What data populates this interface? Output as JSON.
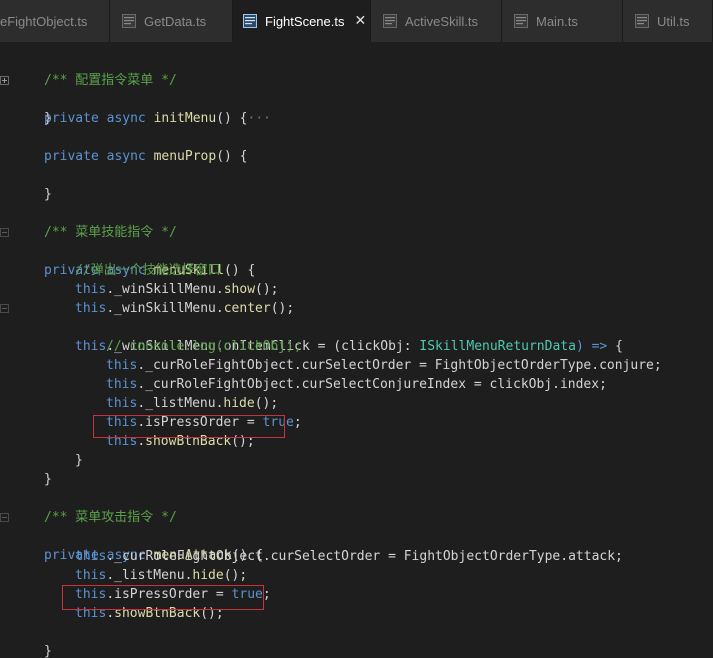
{
  "tabs": [
    {
      "label": "eFightObject.ts",
      "active": false
    },
    {
      "label": "GetData.ts",
      "active": false
    },
    {
      "label": "FightScene.ts",
      "active": true
    },
    {
      "label": "ActiveSkill.ts",
      "active": false
    },
    {
      "label": "Main.ts",
      "active": false
    },
    {
      "label": "Util.ts",
      "active": false
    }
  ],
  "close_glyph": "✕",
  "fold_collapsed_marker": "···",
  "code": {
    "l1_comment": "/** 配置指令菜单 */",
    "l2_kw": "private async",
    "l2_fn": "initMenu",
    "l2_rest": "() {",
    "l3": "}",
    "l4_kw": "private async",
    "l4_fn": "menuProp",
    "l4_rest": "() {",
    "l5": "}",
    "l6_comment": "/** 菜单技能指令 */",
    "l7_kw": "private async",
    "l7_fn": "menuSkill",
    "l7_rest": "() {",
    "l8_comment": "//弹出一个技能选择窗口",
    "l9_this": "this",
    "l9_rest": "._winSkillMenu.",
    "l9_fn": "show",
    "l9_end": "();",
    "l10_this": "this",
    "l10_rest": "._winSkillMenu.",
    "l10_fn": "center",
    "l10_end": "();",
    "l11_this": "this",
    "l11_rest": "._winSkillMenu.onItemClick = (",
    "l11_param": "clickObj",
    "l11_colon": ": ",
    "l11_type": "ISkillMenuReturnData",
    "l11_arrow": ") =>",
    "l11_end": " {",
    "l12_comment": "// console.log(clickObj);",
    "l13_this": "this",
    "l13_rest": "._curRoleFightObject.curSelectOrder = FightObjectOrderType.conjure;",
    "l14_this": "this",
    "l14_rest": "._curRoleFightObject.curSelectConjureIndex = clickObj.index;",
    "l15_this": "this",
    "l15_rest": "._listMenu.",
    "l15_fn": "hide",
    "l15_end": "();",
    "l16_this": "this",
    "l16_rest": ".isPressOrder = ",
    "l16_val": "true",
    "l16_end": ";",
    "l17_this": "this",
    "l17_rest": ".",
    "l17_fn": "showBtnBack",
    "l17_end": "();",
    "l18": "}",
    "l19": "}",
    "l20_comment": "/** 菜单攻击指令 */",
    "l21_kw": "private async",
    "l21_fn": "menuAttack",
    "l21_rest": "() {",
    "l22_this": "this",
    "l22_rest": "._curRoleFightObject.curSelectOrder = FightObjectOrderType.attack;",
    "l23_this": "this",
    "l23_rest": "._listMenu.",
    "l23_fn": "hide",
    "l23_end": "();",
    "l24_this": "this",
    "l24_rest": ".isPressOrder = ",
    "l24_val": "true",
    "l24_end": ";",
    "l25_this": "this",
    "l25_rest": ".",
    "l25_fn": "showBtnBack",
    "l25_end": "();",
    "l26": "}"
  },
  "colors": {
    "background": "#1e1e1e",
    "highlight_box": "#c8323c",
    "comment": "#5ba14a",
    "keyword": "#5b93d1",
    "function": "#dcdcaa",
    "type": "#4ec9b0"
  }
}
